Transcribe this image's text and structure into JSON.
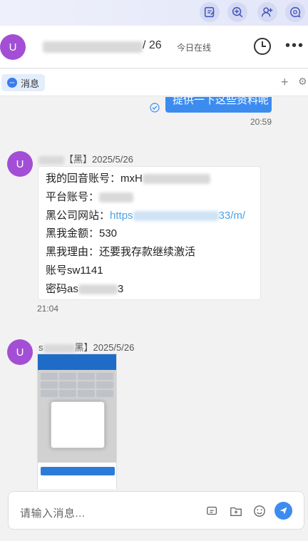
{
  "toolbar": {
    "icons": [
      "note-icon",
      "zoom-in-icon",
      "add-user-icon",
      "chat-search-icon"
    ]
  },
  "header": {
    "avatar": "U",
    "date_suffix": "/ 26",
    "status": "今日在线"
  },
  "tabs": {
    "message_label": "消息",
    "add": "+",
    "settings": "⚙"
  },
  "chat": {
    "sent_message": "提供一下这些资料呢",
    "sent_time": "20:59",
    "messages": [
      {
        "avatar": "U",
        "sender_suffix": "【黑】2025/5/26",
        "lines": [
          {
            "prefix": "我的回音账号：mxH",
            "suffix": ""
          },
          {
            "prefix": "平台账号：",
            "suffix": ""
          },
          {
            "prefix": "黑公司网站：",
            "link_start": "https",
            "link_end": "33/m/"
          },
          {
            "prefix": "黑我金额：530",
            "suffix": ""
          },
          {
            "prefix": "黑我理由：还要我存款继续激活",
            "suffix": ""
          },
          {
            "prefix": "账号sw1141",
            "suffix": ""
          },
          {
            "prefix": "密码as",
            "suffix": "3"
          }
        ],
        "time": "21:04"
      },
      {
        "avatar": "U",
        "sender_prefix": "s",
        "sender_suffix": "黑】2025/5/26"
      }
    ]
  },
  "composer": {
    "placeholder": "请输入消息..."
  },
  "colors": {
    "accent": "#3c8cf0",
    "avatar": "#a24fd6",
    "link": "#4aa3e8"
  }
}
